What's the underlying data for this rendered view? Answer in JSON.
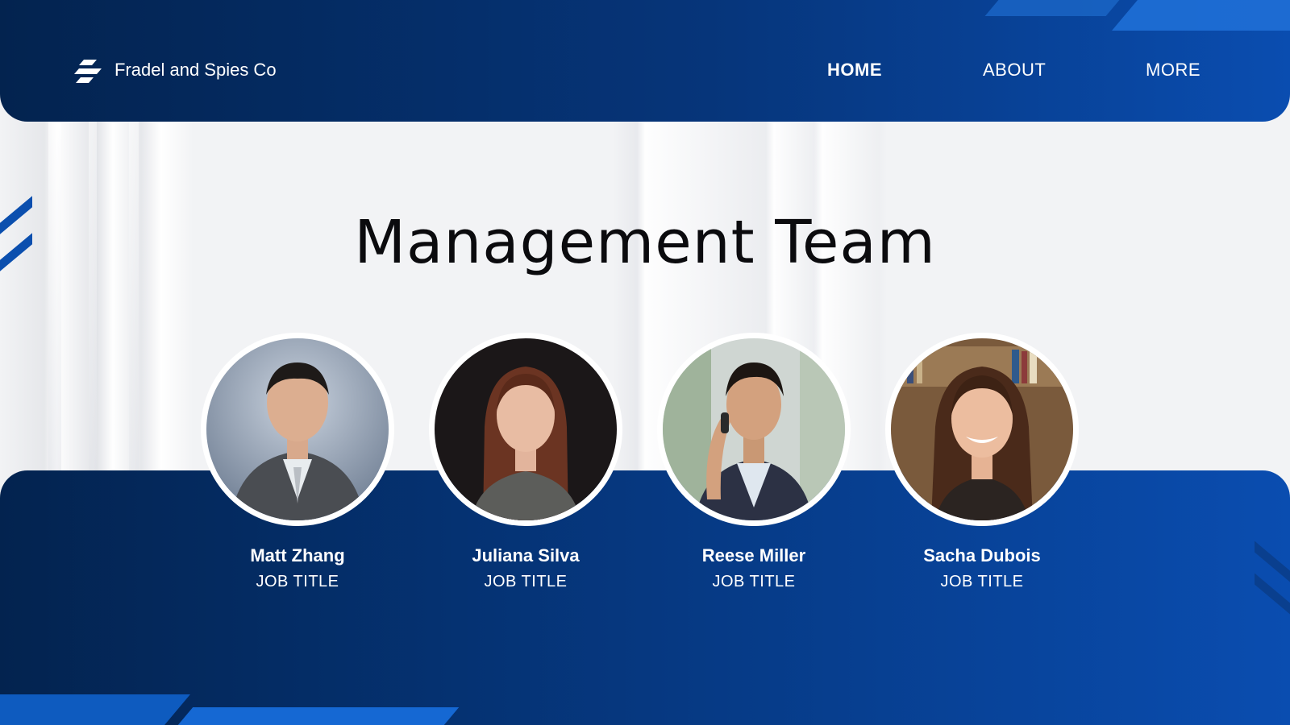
{
  "header": {
    "brand": "Fradel and Spies Co",
    "logo_icon": "stacked-stripes-logo-icon",
    "nav": [
      {
        "label": "HOME",
        "active": true
      },
      {
        "label": "ABOUT",
        "active": false
      },
      {
        "label": "MORE",
        "active": false
      }
    ]
  },
  "main": {
    "title": "Management Team",
    "members": [
      {
        "name": "Matt Zhang",
        "title": "JOB TITLE",
        "portrait": "man-in-grey-suit-portrait"
      },
      {
        "name": "Juliana Silva",
        "title": "JOB TITLE",
        "portrait": "woman-with-auburn-hair-portrait"
      },
      {
        "name": "Reese Miller",
        "title": "JOB TITLE",
        "portrait": "man-on-phone-call-portrait"
      },
      {
        "name": "Sacha Dubois",
        "title": "JOB TITLE",
        "portrait": "smiling-woman-bookshelf-portrait"
      }
    ]
  },
  "colors": {
    "navy": "#03234f",
    "royal_blue": "#0a4db0",
    "accent_blue": "#1167d6",
    "background": "#f2f3f5"
  }
}
